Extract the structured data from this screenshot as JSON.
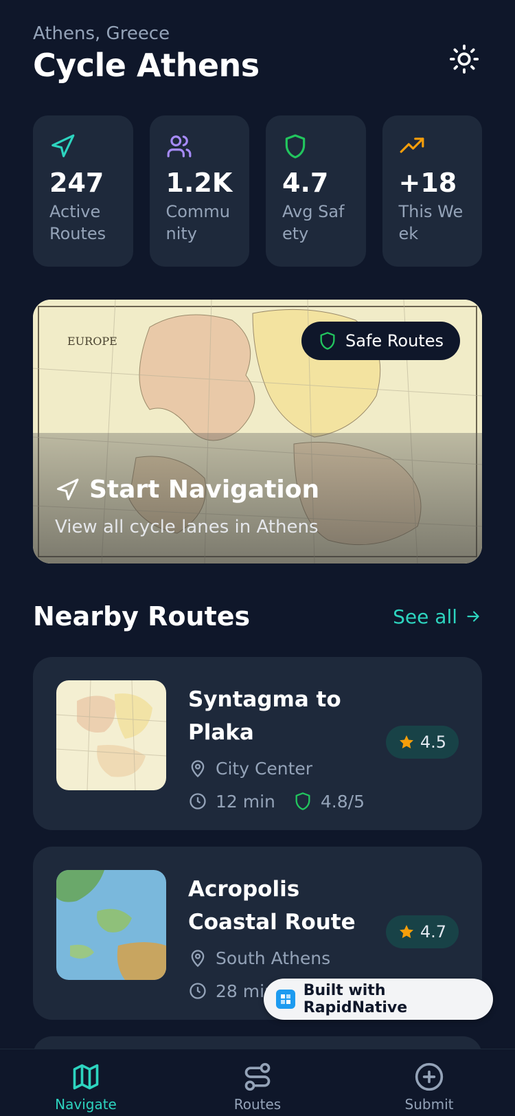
{
  "header": {
    "city": "Athens, Greece",
    "title": "Cycle Athens",
    "theme_icon": "sun-icon"
  },
  "stats": [
    {
      "icon": "navigation-icon",
      "value": "247",
      "label": "Active Routes",
      "color": "#2dd4bf"
    },
    {
      "icon": "users-icon",
      "value": "1.2K",
      "label": "Community",
      "color": "#a78bfa"
    },
    {
      "icon": "shield-icon",
      "value": "4.7",
      "label": "Avg Safety",
      "color": "#22c55e"
    },
    {
      "icon": "trending-up-icon",
      "value": "+18",
      "label": "This Week",
      "color": "#f59e0b"
    }
  ],
  "hero": {
    "badge": "Safe Routes",
    "title": "Start Navigation",
    "subtitle": "View all cycle lanes in Athens",
    "map_label": "EUROPE"
  },
  "nearby": {
    "title": "Nearby Routes",
    "see_all": "See all"
  },
  "routes": [
    {
      "name": "Syntagma to Plaka",
      "area": "City Center",
      "time": "12 min",
      "safety": "4.8/5",
      "rating": "4.5"
    },
    {
      "name": "Acropolis Coastal Route",
      "area": "South Athens",
      "time": "28 min",
      "safety": "",
      "rating": "4.7"
    }
  ],
  "badge": {
    "label": "Built with RapidNative"
  },
  "tabs": [
    {
      "label": "Navigate",
      "icon": "map-icon",
      "active": true
    },
    {
      "label": "Routes",
      "icon": "route-icon",
      "active": false
    },
    {
      "label": "Submit",
      "icon": "plus-circle-icon",
      "active": false
    }
  ],
  "colors": {
    "background": "#0f172a",
    "card": "#1e293b",
    "accent": "#2dd4bf",
    "star": "#f59e0b"
  }
}
